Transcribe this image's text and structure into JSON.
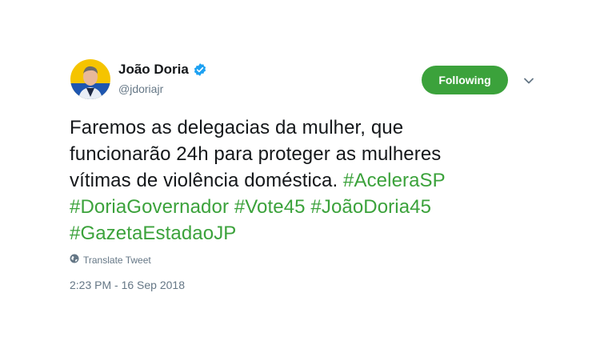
{
  "user": {
    "display_name": "João Doria",
    "handle": "@jdoriajr",
    "verified": true
  },
  "follow_button": {
    "label": "Following"
  },
  "tweet": {
    "line1": "Faremos as delegacias da mulher, que",
    "line2": "funcionarão 24h para proteger as mulheres",
    "line3_text": "vítimas de violência doméstica.",
    "hashtags": [
      "#AceleraSP",
      "#DoriaGovernador",
      "#Vote45",
      "#JoãoDoria45",
      "#GazetaEstadaoJP"
    ]
  },
  "translate_label": "Translate Tweet",
  "timestamp": "2:23 PM - 16 Sep 2018",
  "colors": {
    "accent": "#3ba23b",
    "verified": "#1da1f2",
    "secondary_text": "#657786",
    "avatar_bg": "#f5c400"
  },
  "icons": {
    "verified": "verified-badge-icon",
    "caret": "chevron-down-icon",
    "translate": "globe-icon"
  }
}
